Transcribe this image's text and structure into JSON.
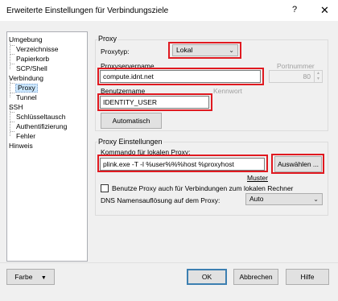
{
  "window": {
    "title": "Erweiterte Einstellungen für Verbindungsziele",
    "help_label": "?",
    "close_label": "✕"
  },
  "tree": {
    "items": [
      {
        "label": "Umgebung"
      },
      {
        "label": "Verzeichnisse"
      },
      {
        "label": "Papierkorb"
      },
      {
        "label": "SCP/Shell"
      },
      {
        "label": "Verbindung"
      },
      {
        "label": "Proxy",
        "selected": true
      },
      {
        "label": "Tunnel"
      },
      {
        "label": "SSH"
      },
      {
        "label": "Schlüsseltausch"
      },
      {
        "label": "Authentifizierung"
      },
      {
        "label": "Fehler"
      },
      {
        "label": "Hinweis"
      }
    ]
  },
  "proxy_group": {
    "title": "Proxy",
    "type_label": "Proxytyp:",
    "type_value": "Lokal",
    "server_label": "Proxyservername",
    "server_value": "compute.idnt.net",
    "port_label": "Portnummer",
    "port_value": "80",
    "user_label": "Benutzername",
    "user_value": "IDENTITY_USER",
    "password_label": "Kennwort",
    "auto_button": "Automatisch"
  },
  "settings_group": {
    "title": "Proxy Einstellungen",
    "command_label": "Kommando für lokalen Proxy:",
    "command_value": "plink.exe -T -l %user%%%host %proxyhost",
    "browse_button": "Auswählen ...",
    "pattern_label": "Muster",
    "checkbox_label": "Benutze Proxy auch für Verbindungen zum lokalen Rechner",
    "checkbox_checked": false,
    "dns_label": "DNS Namensauflösung auf dem Proxy:",
    "dns_value": "Auto"
  },
  "footer": {
    "color_button": "Farbe",
    "ok_button": "OK",
    "cancel_button": "Abbrechen",
    "help_button": "Hilfe"
  },
  "colors": {
    "highlight": "#e01920",
    "selection": "#cce8ff"
  }
}
